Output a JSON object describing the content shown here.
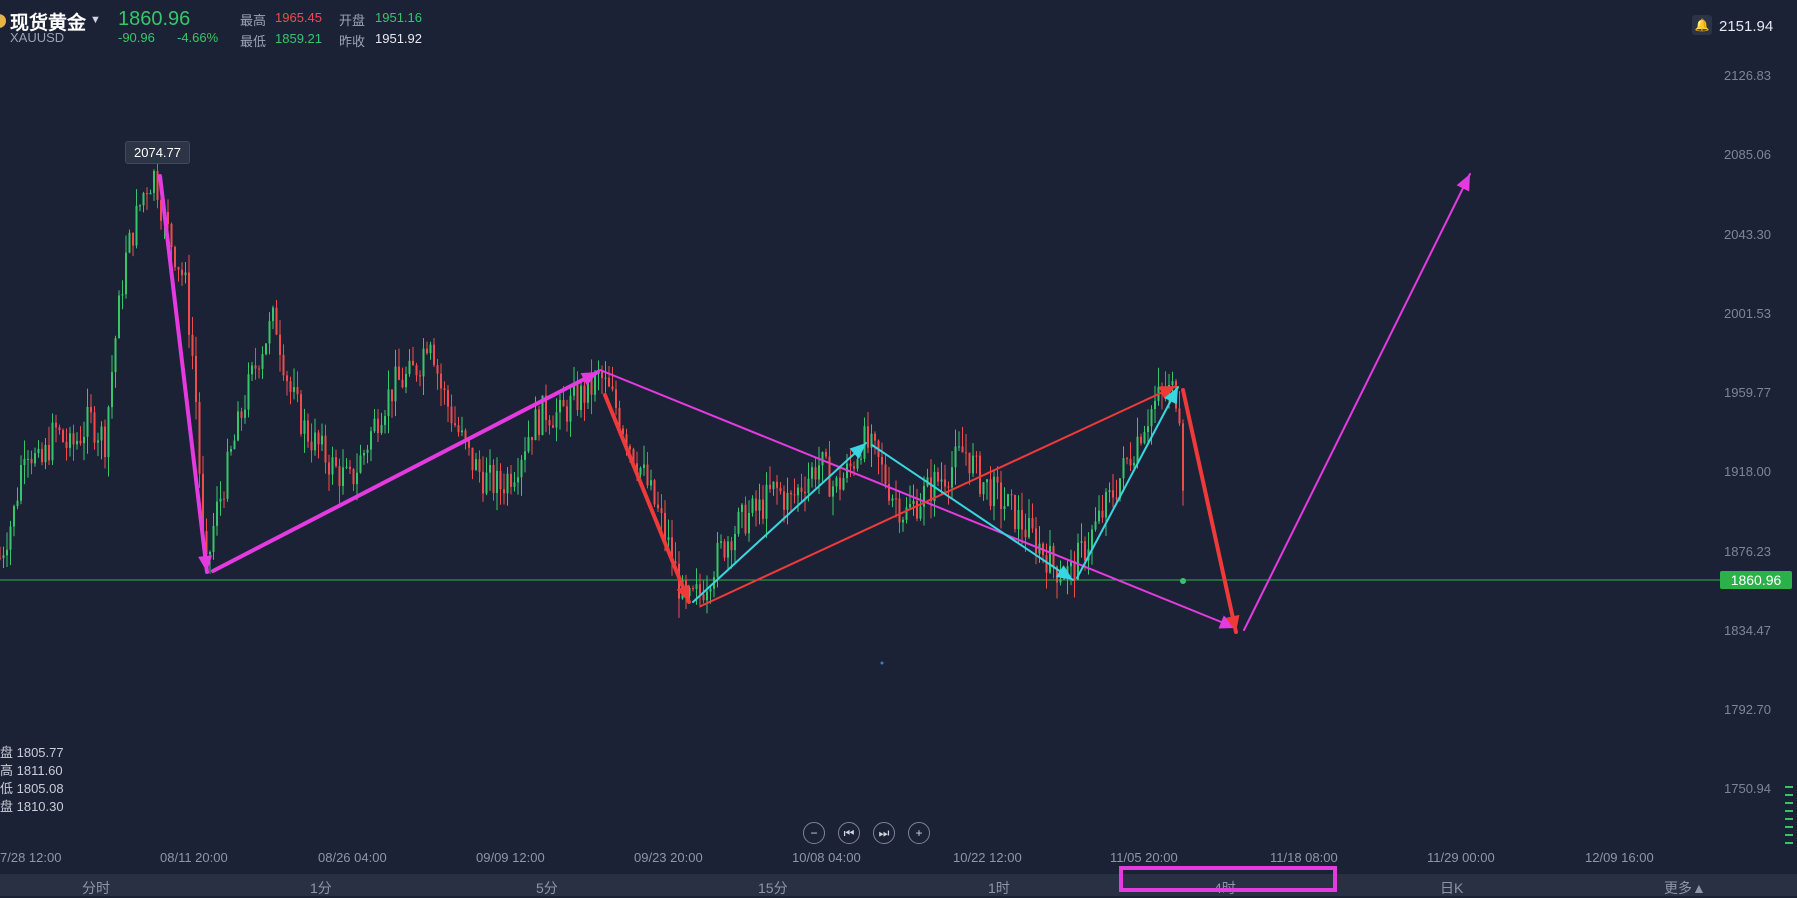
{
  "header": {
    "title": "现货黄金",
    "symbol": "XAUUSD",
    "price": "1860.96",
    "change": "-90.96",
    "change_pct": "-4.66%",
    "high_label": "最高",
    "high": "1965.45",
    "open_label": "开盘",
    "open": "1951.16",
    "low_label": "最低",
    "low": "1859.21",
    "prev_close_label": "昨收",
    "prev_close": "1951.92",
    "alert_price": "2151.94"
  },
  "y_axis": [
    "2126.83",
    "2085.06",
    "2043.30",
    "2001.53",
    "1959.77",
    "1918.00",
    "1876.23",
    "1834.47",
    "1792.70",
    "1750.94"
  ],
  "current_price_tag": "1860.96",
  "peak_tooltip": "2074.77",
  "ohlc_panel": {
    "open": "盘 1805.77",
    "high": "高 1811.60",
    "low": "低 1805.08",
    "close": "盘 1810.30"
  },
  "x_axis": [
    "7/28 12:00",
    "08/11 20:00",
    "08/26 04:00",
    "09/09 12:00",
    "09/23 20:00",
    "10/08 04:00",
    "10/22 12:00",
    "11/05 20:00",
    "11/18 08:00",
    "11/29 00:00",
    "12/09 16:00"
  ],
  "controls": [
    "−",
    "⏮",
    "⏭",
    "+"
  ],
  "tabs": [
    "分时",
    "1分",
    "5分",
    "15分",
    "1时",
    "4时",
    "日K",
    "更多▲"
  ],
  "selected_tab": "4时",
  "colors": {
    "background": "#1c2235",
    "up": "#37c56b",
    "down": "#ef4d4d",
    "annotation_magenta": "#e43be0",
    "annotation_red": "#f03a3a",
    "annotation_cyan": "#3ad6e0"
  },
  "chart_data": {
    "type": "candlestick",
    "y_range": [
      1750.94,
      2151.94
    ],
    "price_path": [
      [
        0,
        1880
      ],
      [
        15,
        1905
      ],
      [
        25,
        1940
      ],
      [
        40,
        1925
      ],
      [
        55,
        1945
      ],
      [
        70,
        1935
      ],
      [
        90,
        1950
      ],
      [
        105,
        1940
      ],
      [
        115,
        1990
      ],
      [
        125,
        2030
      ],
      [
        135,
        2050
      ],
      [
        145,
        2068
      ],
      [
        155,
        2074.77
      ],
      [
        165,
        2050
      ],
      [
        175,
        2035
      ],
      [
        185,
        2020
      ],
      [
        195,
        1970
      ],
      [
        205,
        1868
      ],
      [
        215,
        1900
      ],
      [
        230,
        1930
      ],
      [
        245,
        1960
      ],
      [
        260,
        1985
      ],
      [
        275,
        2002
      ],
      [
        290,
        1965
      ],
      [
        305,
        1945
      ],
      [
        320,
        1935
      ],
      [
        335,
        1925
      ],
      [
        350,
        1918
      ],
      [
        365,
        1935
      ],
      [
        380,
        1955
      ],
      [
        395,
        1968
      ],
      [
        410,
        1972
      ],
      [
        420,
        1980
      ],
      [
        430,
        1996
      ],
      [
        440,
        1968
      ],
      [
        455,
        1948
      ],
      [
        470,
        1930
      ],
      [
        485,
        1920
      ],
      [
        500,
        1916
      ],
      [
        515,
        1926
      ],
      [
        530,
        1945
      ],
      [
        545,
        1955
      ],
      [
        560,
        1952
      ],
      [
        575,
        1960
      ],
      [
        590,
        1965
      ],
      [
        600,
        1972
      ],
      [
        615,
        1958
      ],
      [
        630,
        1938
      ],
      [
        645,
        1920
      ],
      [
        660,
        1900
      ],
      [
        672,
        1880
      ],
      [
        685,
        1855
      ],
      [
        700,
        1862
      ],
      [
        715,
        1878
      ],
      [
        730,
        1892
      ],
      [
        745,
        1900
      ],
      [
        760,
        1905
      ],
      [
        775,
        1915
      ],
      [
        790,
        1908
      ],
      [
        805,
        1920
      ],
      [
        820,
        1928
      ],
      [
        835,
        1915
      ],
      [
        850,
        1925
      ],
      [
        862,
        1940
      ],
      [
        875,
        1932
      ],
      [
        890,
        1915
      ],
      [
        905,
        1902
      ],
      [
        920,
        1910
      ],
      [
        935,
        1918
      ],
      [
        950,
        1925
      ],
      [
        965,
        1935
      ],
      [
        980,
        1920
      ],
      [
        995,
        1912
      ],
      [
        1010,
        1905
      ],
      [
        1025,
        1895
      ],
      [
        1040,
        1886
      ],
      [
        1055,
        1875
      ],
      [
        1070,
        1872
      ],
      [
        1085,
        1885
      ],
      [
        1100,
        1900
      ],
      [
        1115,
        1915
      ],
      [
        1130,
        1932
      ],
      [
        1145,
        1950
      ],
      [
        1160,
        1962
      ],
      [
        1175,
        1965.45
      ],
      [
        1182,
        1951.16
      ],
      [
        1185,
        1860.96
      ]
    ]
  },
  "annotations": {
    "arrows": [
      {
        "color": "magenta",
        "from": [
          1918,
          1917
        ],
        "to": [
          1868,
          1858
        ]
      },
      {
        "color": "magenta",
        "from": [
          1960,
          1981
        ],
        "to": [
          1964,
          1997
        ]
      },
      {
        "color": "magenta",
        "from": [
          1947,
          2018
        ],
        "to": [
          1977,
          2095
        ]
      },
      {
        "color": "magenta",
        "from": [
          1918,
          1816
        ],
        "to": [
          1883,
          1824
        ]
      },
      {
        "color": "magenta",
        "from": [
          1946,
          1884
        ],
        "to": [
          1964,
          1920
        ]
      }
    ]
  }
}
